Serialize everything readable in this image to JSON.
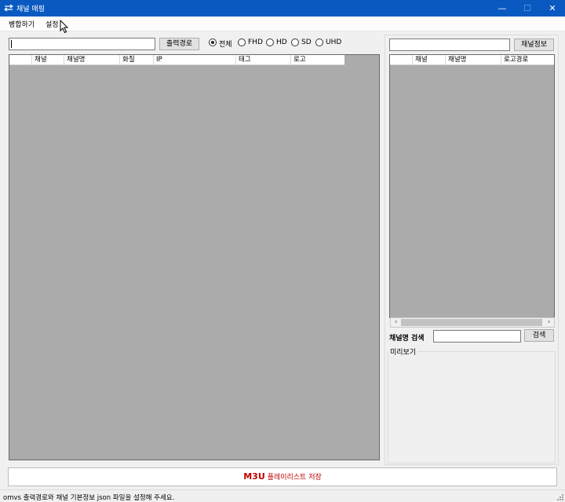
{
  "window": {
    "title": "채널 매핑",
    "minimize_glyph": "—",
    "maximize_glyph": "☐",
    "close_glyph": "✕"
  },
  "menu": [
    "병합하기",
    "설정"
  ],
  "left_panel": {
    "path_input_value": "",
    "output_path_button": "출력경로",
    "radio_options": [
      {
        "label": "전체",
        "selected": true
      },
      {
        "label": "FHD",
        "selected": false
      },
      {
        "label": "HD",
        "selected": false
      },
      {
        "label": "SD",
        "selected": false
      },
      {
        "label": "UHD",
        "selected": false
      }
    ],
    "grid_columns": [
      "채널",
      "채널명",
      "화질",
      "IP",
      "태그",
      "로고"
    ]
  },
  "right_panel": {
    "info_input_value": "",
    "channel_info_button": "채널정보",
    "grid_columns": [
      "채널",
      "채널명",
      "로고경로"
    ],
    "scroll_left_glyph": "‹",
    "scroll_right_glyph": "›",
    "search_label": "채널명 검색",
    "search_input_value": "",
    "search_button": "검색",
    "preview_label": "미리보기"
  },
  "save_button": {
    "m3u": "M3U",
    "text": "플레이리스트 저장"
  },
  "status": {
    "text": "omvs 출력경로와 채널 기본정보 json 파일을 설정해 주세요."
  },
  "colors": {
    "titlebar": "#0a59c1",
    "grid_background": "#ababab",
    "save_text": "#c00000"
  }
}
